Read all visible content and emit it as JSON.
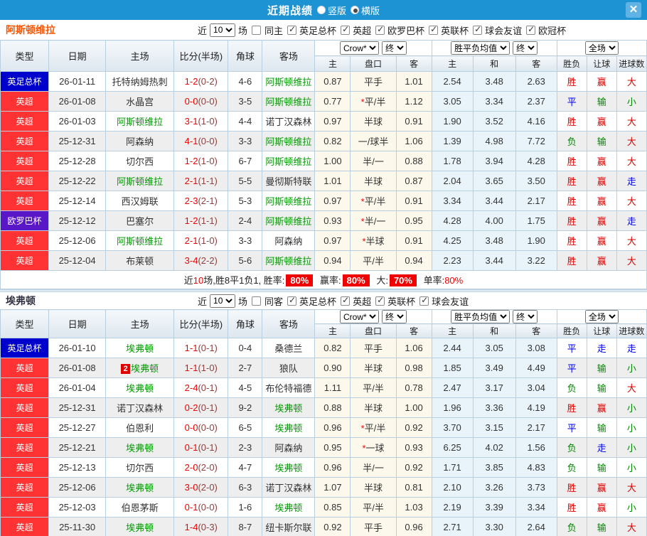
{
  "titlebar": {
    "title": "近期战绩",
    "radio_vertical": "竖版",
    "radio_horizontal": "横版",
    "selected_layout": "横版",
    "close_glyph": "✕"
  },
  "colors": {
    "titlebar_bg": "#1e93d4",
    "league": {
      "英足总杯": "#0000cc",
      "英超": "#ff3333",
      "欧罗巴杯": "#5a17c8"
    },
    "team_green": "#009900",
    "score_ft": "#f00000",
    "score_ht": "#8b4141",
    "result": {
      "胜": "#dd0000",
      "赢": "#dd0000",
      "大": "#dd0000",
      "平": "#0000ee",
      "走": "#0000ee",
      "负": "#008800",
      "输": "#008800",
      "小": "#008800"
    }
  },
  "table_header": {
    "type": "类型",
    "date": "日期",
    "home": "主场",
    "score": "比分(半场)",
    "corner": "角球",
    "away": "客场",
    "odds_company_select": "Crow*",
    "odds_final_select": "终",
    "avg_select": "胜平负均值",
    "avg_final_select": "终",
    "scope_select": "全场",
    "odds_cols": [
      "主",
      "盘口",
      "客"
    ],
    "avg_cols": [
      "主",
      "和",
      "客"
    ],
    "result_cols": [
      "胜负",
      "让球",
      "进球数"
    ]
  },
  "sections": [
    {
      "team": "阿斯顿维拉",
      "team_color": "#ff5500",
      "filter": {
        "near_label": "近",
        "count": "10",
        "games_label": "场",
        "same_label": "同主",
        "same_checked": false,
        "leagues": [
          "英足总杯",
          "英超",
          "欧罗巴杯",
          "英联杯",
          "球会友谊",
          "欧冠杯"
        ]
      },
      "rows": [
        {
          "league": "英足总杯",
          "date": "26-01-11",
          "home": "托特纳姆热刺",
          "home_green": false,
          "score": "1-2",
          "half": "(0-2)",
          "corner": "4-6",
          "away": "阿斯顿维拉",
          "away_green": true,
          "o1": "0.87",
          "hcap": "平手",
          "o2": "1.01",
          "a1": "2.54",
          "a2": "3.48",
          "a3": "2.63",
          "r": [
            "胜",
            "赢",
            "大"
          ]
        },
        {
          "league": "英超",
          "date": "26-01-08",
          "home": "水晶宫",
          "home_green": false,
          "score": "0-0",
          "half": "(0-0)",
          "corner": "3-5",
          "away": "阿斯顿维拉",
          "away_green": true,
          "o1": "0.77",
          "hcap": "*平/半",
          "o2": "1.12",
          "a1": "3.05",
          "a2": "3.34",
          "a3": "2.37",
          "r": [
            "平",
            "输",
            "小"
          ]
        },
        {
          "league": "英超",
          "date": "26-01-03",
          "home": "阿斯顿维拉",
          "home_green": true,
          "score": "3-1",
          "half": "(1-0)",
          "corner": "4-4",
          "away": "诺丁汉森林",
          "away_green": false,
          "o1": "0.97",
          "hcap": "半球",
          "o2": "0.91",
          "a1": "1.90",
          "a2": "3.52",
          "a3": "4.16",
          "r": [
            "胜",
            "赢",
            "大"
          ]
        },
        {
          "league": "英超",
          "date": "25-12-31",
          "home": "阿森纳",
          "home_green": false,
          "score": "4-1",
          "half": "(0-0)",
          "corner": "3-3",
          "away": "阿斯顿维拉",
          "away_green": true,
          "o1": "0.82",
          "hcap": "一/球半",
          "o2": "1.06",
          "a1": "1.39",
          "a2": "4.98",
          "a3": "7.72",
          "r": [
            "负",
            "输",
            "大"
          ]
        },
        {
          "league": "英超",
          "date": "25-12-28",
          "home": "切尔西",
          "home_green": false,
          "score": "1-2",
          "half": "(1-0)",
          "corner": "6-7",
          "away": "阿斯顿维拉",
          "away_green": true,
          "o1": "1.00",
          "hcap": "半/一",
          "o2": "0.88",
          "a1": "1.78",
          "a2": "3.94",
          "a3": "4.28",
          "r": [
            "胜",
            "赢",
            "大"
          ]
        },
        {
          "league": "英超",
          "date": "25-12-22",
          "home": "阿斯顿维拉",
          "home_green": true,
          "score": "2-1",
          "half": "(1-1)",
          "corner": "5-5",
          "away": "曼彻斯特联",
          "away_green": false,
          "o1": "1.01",
          "hcap": "半球",
          "o2": "0.87",
          "a1": "2.04",
          "a2": "3.65",
          "a3": "3.50",
          "r": [
            "胜",
            "赢",
            "走"
          ]
        },
        {
          "league": "英超",
          "date": "25-12-14",
          "home": "西汉姆联",
          "home_green": false,
          "score": "2-3",
          "half": "(2-1)",
          "corner": "5-3",
          "away": "阿斯顿维拉",
          "away_green": true,
          "o1": "0.97",
          "hcap": "*平/半",
          "o2": "0.91",
          "a1": "3.34",
          "a2": "3.44",
          "a3": "2.17",
          "r": [
            "胜",
            "赢",
            "大"
          ]
        },
        {
          "league": "欧罗巴杯",
          "date": "25-12-12",
          "home": "巴塞尔",
          "home_green": false,
          "score": "1-2",
          "half": "(1-1)",
          "corner": "2-4",
          "away": "阿斯顿维拉",
          "away_green": true,
          "o1": "0.93",
          "hcap": "*半/一",
          "o2": "0.95",
          "a1": "4.28",
          "a2": "4.00",
          "a3": "1.75",
          "r": [
            "胜",
            "赢",
            "走"
          ]
        },
        {
          "league": "英超",
          "date": "25-12-06",
          "home": "阿斯顿维拉",
          "home_green": true,
          "score": "2-1",
          "half": "(1-0)",
          "corner": "3-3",
          "away": "阿森纳",
          "away_green": false,
          "o1": "0.97",
          "hcap": "*半球",
          "o2": "0.91",
          "a1": "4.25",
          "a2": "3.48",
          "a3": "1.90",
          "r": [
            "胜",
            "赢",
            "大"
          ]
        },
        {
          "league": "英超",
          "date": "25-12-04",
          "home": "布莱顿",
          "home_green": false,
          "score": "3-4",
          "half": "(2-2)",
          "corner": "5-6",
          "away": "阿斯顿维拉",
          "away_green": true,
          "o1": "0.94",
          "hcap": "平/半",
          "o2": "0.94",
          "a1": "2.23",
          "a2": "3.44",
          "a3": "3.22",
          "r": [
            "胜",
            "赢",
            "大"
          ]
        }
      ],
      "summary": {
        "p1": "近",
        "num": "10",
        "p2": "场,胜8平1负1,",
        "items": [
          {
            "label": "胜率:",
            "value": "80%",
            "badge": true
          },
          {
            "label": "赢率:",
            "value": "80%",
            "badge": true
          },
          {
            "label": "大:",
            "value": "70%",
            "badge": true
          },
          {
            "label": "单率:",
            "value": "80%",
            "badge": false
          }
        ]
      }
    },
    {
      "team": "埃弗顿",
      "team_color": "#333344",
      "filter": {
        "near_label": "近",
        "count": "10",
        "games_label": "场",
        "same_label": "同客",
        "same_checked": false,
        "leagues": [
          "英足总杯",
          "英超",
          "英联杯",
          "球会友谊"
        ]
      },
      "rows": [
        {
          "league": "英足总杯",
          "date": "26-01-10",
          "home": "埃弗顿",
          "home_green": true,
          "score": "1-1",
          "half": "(0-1)",
          "corner": "0-4",
          "away": "桑德兰",
          "away_green": false,
          "o1": "0.82",
          "hcap": "平手",
          "o2": "1.06",
          "a1": "2.44",
          "a2": "3.05",
          "a3": "3.08",
          "r": [
            "平",
            "走",
            "走"
          ]
        },
        {
          "league": "英超",
          "date": "26-01-08",
          "home": "埃弗顿",
          "home_green": true,
          "home_badge": "2",
          "score": "1-1",
          "half": "(1-0)",
          "corner": "2-7",
          "away": "狼队",
          "away_green": false,
          "o1": "0.90",
          "hcap": "半球",
          "o2": "0.98",
          "a1": "1.85",
          "a2": "3.49",
          "a3": "4.49",
          "r": [
            "平",
            "输",
            "小"
          ]
        },
        {
          "league": "英超",
          "date": "26-01-04",
          "home": "埃弗顿",
          "home_green": true,
          "score": "2-4",
          "half": "(0-1)",
          "corner": "4-5",
          "away": "布伦特福德",
          "away_green": false,
          "o1": "1.11",
          "hcap": "平/半",
          "o2": "0.78",
          "a1": "2.47",
          "a2": "3.17",
          "a3": "3.04",
          "r": [
            "负",
            "输",
            "大"
          ]
        },
        {
          "league": "英超",
          "date": "25-12-31",
          "home": "诺丁汉森林",
          "home_green": false,
          "score": "0-2",
          "half": "(0-1)",
          "corner": "9-2",
          "away": "埃弗顿",
          "away_green": true,
          "o1": "0.88",
          "hcap": "半球",
          "o2": "1.00",
          "a1": "1.96",
          "a2": "3.36",
          "a3": "4.19",
          "r": [
            "胜",
            "赢",
            "小"
          ]
        },
        {
          "league": "英超",
          "date": "25-12-27",
          "home": "伯恩利",
          "home_green": false,
          "score": "0-0",
          "half": "(0-0)",
          "corner": "6-5",
          "away": "埃弗顿",
          "away_green": true,
          "o1": "0.96",
          "hcap": "*平/半",
          "o2": "0.92",
          "a1": "3.70",
          "a2": "3.15",
          "a3": "2.17",
          "r": [
            "平",
            "输",
            "小"
          ]
        },
        {
          "league": "英超",
          "date": "25-12-21",
          "home": "埃弗顿",
          "home_green": true,
          "score": "0-1",
          "half": "(0-1)",
          "corner": "2-3",
          "away": "阿森纳",
          "away_green": false,
          "o1": "0.95",
          "hcap": "*一球",
          "o2": "0.93",
          "a1": "6.25",
          "a2": "4.02",
          "a3": "1.56",
          "r": [
            "负",
            "走",
            "小"
          ]
        },
        {
          "league": "英超",
          "date": "25-12-13",
          "home": "切尔西",
          "home_green": false,
          "score": "2-0",
          "half": "(2-0)",
          "corner": "4-7",
          "away": "埃弗顿",
          "away_green": true,
          "o1": "0.96",
          "hcap": "半/一",
          "o2": "0.92",
          "a1": "1.71",
          "a2": "3.85",
          "a3": "4.83",
          "r": [
            "负",
            "输",
            "小"
          ]
        },
        {
          "league": "英超",
          "date": "25-12-06",
          "home": "埃弗顿",
          "home_green": true,
          "score": "3-0",
          "half": "(2-0)",
          "corner": "6-3",
          "away": "诺丁汉森林",
          "away_green": false,
          "o1": "1.07",
          "hcap": "半球",
          "o2": "0.81",
          "a1": "2.10",
          "a2": "3.26",
          "a3": "3.73",
          "r": [
            "胜",
            "赢",
            "大"
          ]
        },
        {
          "league": "英超",
          "date": "25-12-03",
          "home": "伯恩茅斯",
          "home_green": false,
          "score": "0-1",
          "half": "(0-0)",
          "corner": "1-6",
          "away": "埃弗顿",
          "away_green": true,
          "o1": "0.85",
          "hcap": "平/半",
          "o2": "1.03",
          "a1": "2.19",
          "a2": "3.39",
          "a3": "3.34",
          "r": [
            "胜",
            "赢",
            "小"
          ]
        },
        {
          "league": "英超",
          "date": "25-11-30",
          "home": "埃弗顿",
          "home_green": true,
          "score": "1-4",
          "half": "(0-3)",
          "corner": "8-7",
          "away": "纽卡斯尔联",
          "away_green": false,
          "o1": "0.92",
          "hcap": "平手",
          "o2": "0.96",
          "a1": "2.71",
          "a2": "3.30",
          "a3": "2.64",
          "r": [
            "负",
            "输",
            "大"
          ]
        }
      ],
      "summary": null
    }
  ]
}
